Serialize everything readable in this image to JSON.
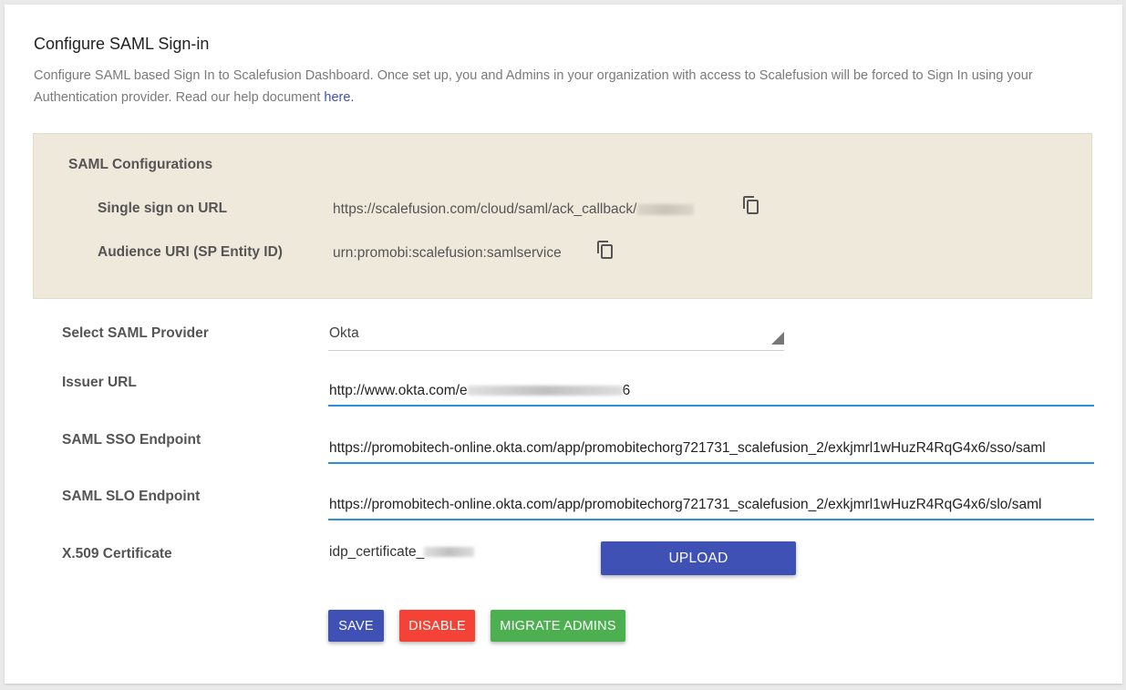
{
  "header": {
    "title": "Configure SAML Sign-in",
    "description": "Configure SAML based Sign In to Scalefusion Dashboard. Once set up, you and Admins in your organization with access to Scalefusion will be forced to Sign In using your Authentication provider. Read our help document",
    "help_link": "here."
  },
  "saml_config": {
    "heading": "SAML Configurations",
    "sso_url_label": "Single sign on URL",
    "sso_url_value": "https://scalefusion.com/cloud/saml/ack_callback/",
    "audience_label": "Audience URI (SP Entity ID)",
    "audience_value": "urn:promobi:scalefusion:samlservice"
  },
  "form": {
    "provider_label": "Select SAML Provider",
    "provider_value": "Okta",
    "issuer_label": "Issuer URL",
    "issuer_value": "http://www.okta.com/e",
    "issuer_tail": "6",
    "sso_endpoint_label": "SAML SSO Endpoint",
    "sso_endpoint_value": "https://promobitech-online.okta.com/app/promobitechorg721731_scalefusion_2/exkjmrl1wHuzR4RqG4x6/sso/saml",
    "slo_endpoint_label": "SAML SLO Endpoint",
    "slo_endpoint_value": "https://promobitech-online.okta.com/app/promobitechorg721731_scalefusion_2/exkjmrl1wHuzR4RqG4x6/slo/saml",
    "cert_label": "X.509 Certificate",
    "cert_value": "idp_certificate_",
    "upload_label": "UPLOAD"
  },
  "actions": {
    "save": "SAVE",
    "disable": "DISABLE",
    "migrate": "MIGRATE ADMINS"
  },
  "colors": {
    "primary": "#3f51b5",
    "danger": "#f44336",
    "success": "#4caf50",
    "config_bg": "#efe9dc",
    "input_underline": "#2f8ed8"
  },
  "icons": {
    "copy": "copy-icon",
    "dropdown": "triangle-dropdown-icon"
  }
}
